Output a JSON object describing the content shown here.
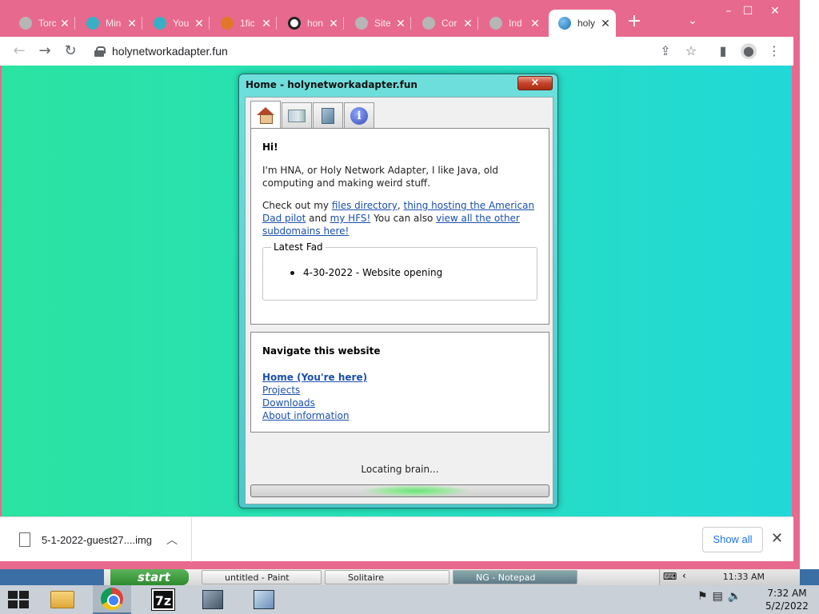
{
  "browser": {
    "tabs": [
      {
        "title": "Torc",
        "color": "#b6b6b6",
        "icon": "globe-icon"
      },
      {
        "title": "Min",
        "color": "#35b0c4",
        "icon": "gear-icon"
      },
      {
        "title": "You",
        "color": "#35b0c4",
        "icon": "gear-icon"
      },
      {
        "title": "1fic",
        "color": "#e0772a",
        "icon": "flame-icon"
      },
      {
        "title": "hon",
        "color": "#222222",
        "icon": "spiral-icon"
      },
      {
        "title": "Site",
        "color": "#b6b6b6",
        "icon": "globe-icon"
      },
      {
        "title": "Cor",
        "color": "#b6b6b6",
        "icon": "globe-icon"
      },
      {
        "title": "Ind",
        "color": "#b6b6b6",
        "icon": "globe-icon"
      },
      {
        "title": "holy",
        "color": "#2a8bd6",
        "icon": "globe-icon"
      }
    ],
    "url": "holynetworkadapter.fun",
    "accent": "#e8698e"
  },
  "dialog": {
    "title": "Home - holynetworkadapter.fun",
    "close": "×",
    "info_glyph": "i",
    "greeting": "Hi!",
    "intro": "I'm HNA, or Holy Network Adapter, I like Java, old computing and making weird stuff.",
    "checkout_prefix": "Check out my ",
    "link_files": "files directory",
    "sep1": ", ",
    "link_dad": "thing hosting the American Dad pilot",
    "sep2": " and ",
    "link_hfs": "my HFS!",
    "sep3": " You can also ",
    "link_subdomains": "view all the other subdomains here!",
    "latest_legend": "Latest Fad",
    "latest_item": "4-30-2022 - Website opening",
    "nav_heading": "Navigate this website",
    "nav_links": [
      "Home (You're here)",
      "Projects",
      "Downloads",
      "About information"
    ],
    "status": "Locating brain...",
    "progress": 0.55
  },
  "downloads": {
    "file": "5-1-2022-guest27....img",
    "show_all": "Show all"
  },
  "xp_taskbar": {
    "start": "start",
    "tasks": [
      "untitled - Paint",
      "Solitaire",
      "NG - Notepad"
    ],
    "clock": "11:33 AM"
  },
  "win10_taskbar": {
    "zip_label": "7z",
    "time": "7:32 AM",
    "date": "5/2/2022"
  }
}
